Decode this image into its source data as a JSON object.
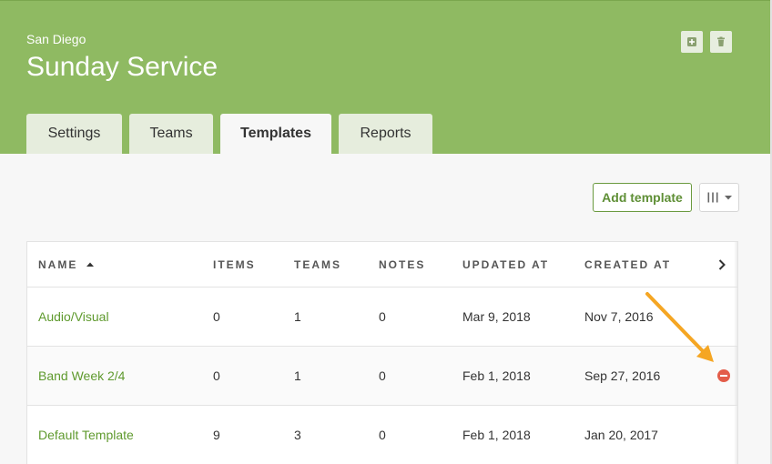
{
  "header": {
    "org": "San Diego",
    "title": "Sunday Service",
    "add_icon": "plus-square-icon",
    "delete_icon": "trash-icon"
  },
  "tabs": [
    {
      "label": "Settings"
    },
    {
      "label": "Teams"
    },
    {
      "label": "Templates",
      "active": true
    },
    {
      "label": "Reports"
    }
  ],
  "toolbar": {
    "add_template_label": "Add template",
    "column_toggle_icon": "columns-icon"
  },
  "table": {
    "columns": [
      "NAME",
      "ITEMS",
      "TEAMS",
      "NOTES",
      "UPDATED AT",
      "CREATED AT"
    ],
    "sort_column": "NAME",
    "sort_direction": "ascending",
    "rows": [
      {
        "name": "Audio/Visual",
        "items": "0",
        "teams": "1",
        "notes": "0",
        "updated": "Mar 9, 2018",
        "created": "Nov 7, 2016"
      },
      {
        "name": "Band Week 2/4",
        "items": "0",
        "teams": "1",
        "notes": "0",
        "updated": "Feb 1, 2018",
        "created": "Sep 27, 2016"
      },
      {
        "name": "Default Template",
        "items": "9",
        "teams": "3",
        "notes": "0",
        "updated": "Feb 1, 2018",
        "created": "Jan 20, 2017"
      }
    ]
  },
  "colors": {
    "header_bg": "#8fba62",
    "link": "#5f9a2e",
    "remove": "#e35d4a",
    "annotation_arrow": "#f5a623"
  }
}
